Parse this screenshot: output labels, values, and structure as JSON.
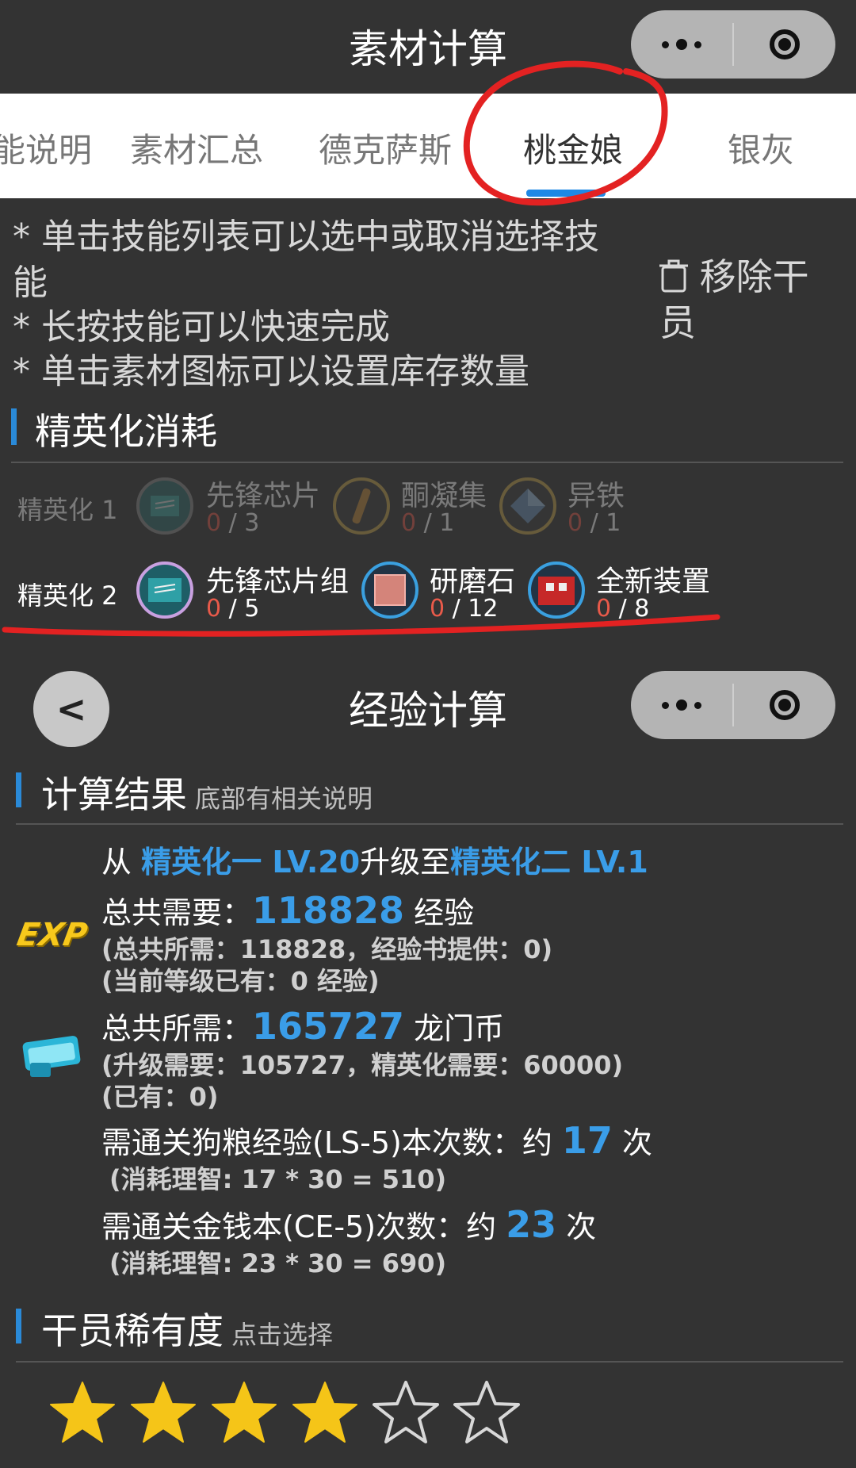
{
  "top_nav": {
    "title": "素材计算"
  },
  "tabs": [
    {
      "label": "能说明"
    },
    {
      "label": "素材汇总"
    },
    {
      "label": "德克萨斯"
    },
    {
      "label": "桃金娘",
      "active": true
    },
    {
      "label": "银灰"
    }
  ],
  "tips": [
    "* 单击技能列表可以选中或取消选择技",
    "能",
    "* 长按技能可以快速完成",
    "* 单击素材图标可以设置库存数量"
  ],
  "remove_operator": "移除干员",
  "elite_section": {
    "title": "精英化消耗",
    "rows": [
      {
        "label": "精英化 1",
        "dim": true,
        "materials": [
          {
            "name": "先锋芯片",
            "have": "0",
            "need": "/ 3"
          },
          {
            "name": "酮凝集",
            "have": "0",
            "need": "/ 1"
          },
          {
            "name": "异铁",
            "have": "0",
            "need": "/ 1"
          }
        ]
      },
      {
        "label": "精英化 2",
        "dim": false,
        "materials": [
          {
            "name": "先锋芯片组",
            "have": "0",
            "need": "/ 5"
          },
          {
            "name": "研磨石",
            "have": "0",
            "need": "/ 12"
          },
          {
            "name": "全新装置",
            "have": "0",
            "need": "/ 8"
          }
        ]
      }
    ]
  },
  "exp_nav": {
    "title": "经验计算",
    "back": "<"
  },
  "result_section": {
    "title": "计算结果",
    "hint": "底部有相关说明",
    "from_prefix": "从 ",
    "from_stage": "精英化一 LV.20",
    "to_word": "升级至",
    "to_stage": "精英化二 LV.1",
    "exp_icon": "EXP",
    "exp_label": "总共需要：",
    "exp_value": "118828",
    "exp_unit": " 经验",
    "exp_detail1": "(总共所需：118828，经验书提供：0)",
    "exp_detail2": "(当前等级已有：0 经验)",
    "coin_label": "总共所需：",
    "coin_value": "165727",
    "coin_unit": " 龙门币",
    "coin_detail1": "(升级需要：105727，精英化需要：60000)",
    "coin_detail2": "(已有：0)",
    "ls_label": "需通关狗粮经验(LS-5)本次数：约 ",
    "ls_value": "17",
    "ls_unit": " 次",
    "ls_detail": "(消耗理智: 17 * 30 = 510)",
    "ce_label": "需通关金钱本(CE-5)次数：约 ",
    "ce_value": "23",
    "ce_unit": " 次",
    "ce_detail": "(消耗理智: 23 * 30 = 690)"
  },
  "rarity_section": {
    "title": "干员稀有度",
    "hint": "点击选择",
    "rating": 4,
    "max": 6
  },
  "colors": {
    "accent": "#2a8ad8",
    "link": "#3a9de8",
    "star": "#f5c518",
    "count_red": "#e85a4a"
  }
}
